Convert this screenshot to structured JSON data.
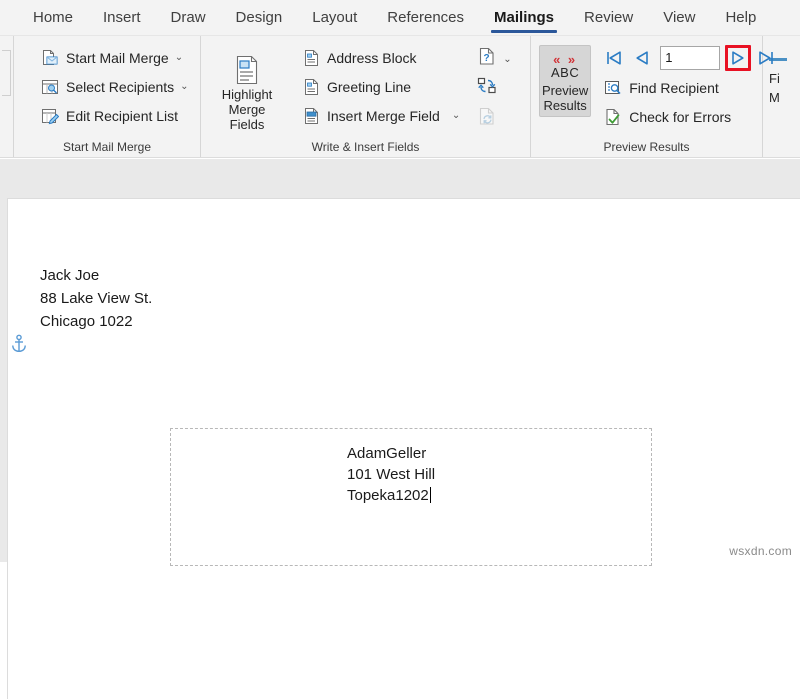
{
  "app": {
    "watermark": "wsxdn.com"
  },
  "tabs": [
    {
      "label": "Home",
      "active": false
    },
    {
      "label": "Insert",
      "active": false
    },
    {
      "label": "Draw",
      "active": false
    },
    {
      "label": "Design",
      "active": false
    },
    {
      "label": "Layout",
      "active": false
    },
    {
      "label": "References",
      "active": false
    },
    {
      "label": "Mailings",
      "active": true
    },
    {
      "label": "Review",
      "active": false
    },
    {
      "label": "View",
      "active": false
    },
    {
      "label": "Help",
      "active": false
    }
  ],
  "ribbon": {
    "accent_color": "#2b579a",
    "highlight_color": "#e81123",
    "groups": {
      "start_mail_merge": {
        "label": "Start Mail Merge",
        "items": [
          {
            "label": "Start Mail Merge",
            "icon": "mail-merge-icon",
            "has_dropdown": true
          },
          {
            "label": "Select Recipients",
            "icon": "select-recipients-icon",
            "has_dropdown": true
          },
          {
            "label": "Edit Recipient List",
            "icon": "edit-recipient-icon",
            "has_dropdown": false
          }
        ]
      },
      "write_insert_fields": {
        "label": "Write & Insert Fields",
        "highlight_merge_fields": {
          "label_line1": "Highlight",
          "label_line2": "Merge Fields",
          "icon": "highlight-merge-fields-icon"
        },
        "items": [
          {
            "label": "Address Block",
            "icon": "address-block-icon",
            "has_dropdown": false
          },
          {
            "label": "Greeting Line",
            "icon": "greeting-line-icon",
            "has_dropdown": false
          },
          {
            "label": "Insert Merge Field",
            "icon": "insert-merge-field-icon",
            "has_dropdown": true
          }
        ],
        "side_icons": [
          {
            "name": "rules-icon",
            "has_dropdown": true,
            "disabled": false
          },
          {
            "name": "match-fields-icon",
            "has_dropdown": false,
            "disabled": false
          },
          {
            "name": "update-labels-icon",
            "has_dropdown": false,
            "disabled": true
          }
        ]
      },
      "preview_results": {
        "label": "Preview Results",
        "preview_button": {
          "glyph": "« »",
          "abc": "ABC",
          "label_line1": "Preview",
          "label_line2": "Results",
          "pressed": true
        },
        "navigation": {
          "first_record": "first-record-icon",
          "previous_record": "previous-record-icon",
          "record_number": "1",
          "next_record": "next-record-icon",
          "last_record": "last-record-icon",
          "highlighted": "next-record-icon"
        },
        "items": [
          {
            "label": "Find Recipient",
            "icon": "find-recipient-icon"
          },
          {
            "label": "Check for Errors",
            "icon": "check-for-errors-icon"
          }
        ]
      },
      "finish": {
        "line1": "Fi",
        "line2": "M"
      }
    }
  },
  "document": {
    "sender_address": {
      "line1": "Jack Joe",
      "line2": "88 Lake View St.",
      "line3": "Chicago 1022"
    },
    "anchor_icon": "anchor-icon",
    "textbox": {
      "line1": "AdamGeller",
      "line2": "101 West Hill",
      "line3": "Topeka1202"
    }
  }
}
